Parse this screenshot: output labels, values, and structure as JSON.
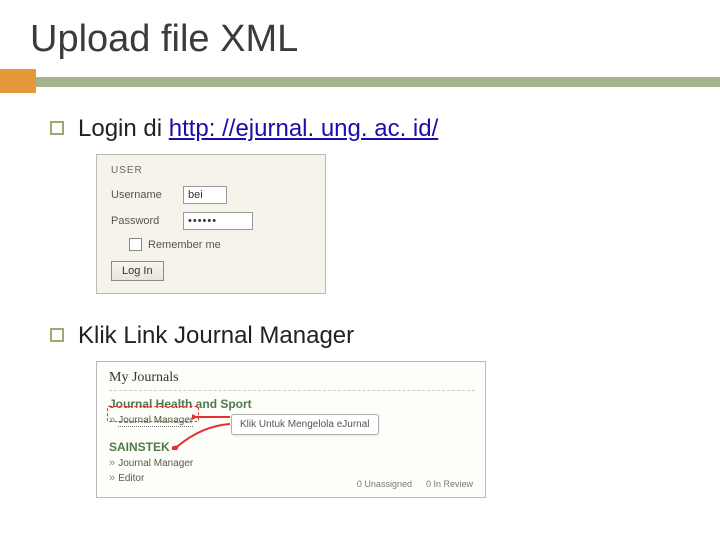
{
  "title": "Upload file XML",
  "bullets": {
    "b1_prefix": "Login di ",
    "b1_link_text": "http: //ejurnal. ung. ac. id/",
    "b2": "Klik Link Journal Manager"
  },
  "login_panel": {
    "heading": "USER",
    "username_label": "Username",
    "username_value": "bei",
    "password_label": "Password",
    "password_value": "••••••",
    "remember_label": "Remember me",
    "button_label": "Log In"
  },
  "journals_panel": {
    "heading": "My Journals",
    "j1_name": "Journal Health and Sport",
    "j1_link": "Journal Manager",
    "j2_name": "SAINSTEK",
    "j2_link1": "Journal Manager",
    "j2_link2": "Editor",
    "status1": "0 Unassigned",
    "status2": "0 In Review",
    "callout": "Klik Untuk Mengelola eJurnal"
  }
}
